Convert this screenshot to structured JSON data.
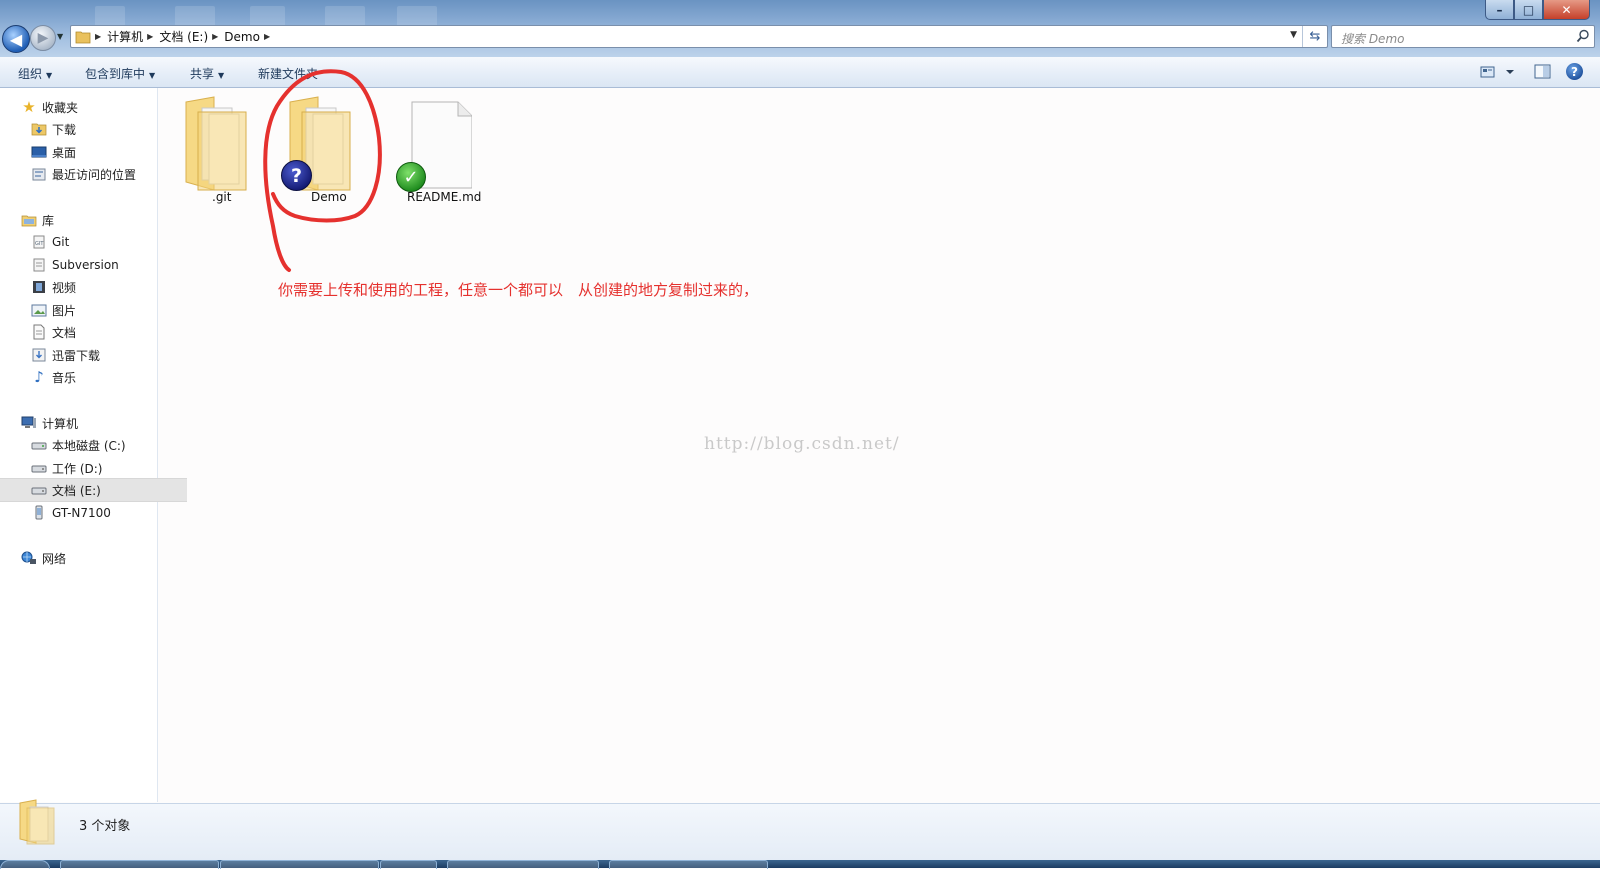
{
  "address": {
    "breadcrumbs": [
      "计算机",
      "文档 (E:)",
      "Demo"
    ]
  },
  "search": {
    "placeholder": "搜索 Demo"
  },
  "toolbar": {
    "organize": "组织",
    "include_in_library": "包含到库中",
    "share": "共享",
    "new_folder": "新建文件夹"
  },
  "window_controls": {
    "minimize": "–",
    "maximize": "□",
    "close": "✕"
  },
  "help": {
    "label": "?"
  },
  "nav": {
    "favorites": "收藏夹",
    "downloads": "下载",
    "desktop": "桌面",
    "recent": "最近访问的位置",
    "libraries": "库",
    "git": "Git",
    "subversion": "Subversion",
    "videos": "视频",
    "pictures": "图片",
    "documents": "文档",
    "thunder": "迅雷下载",
    "music": "音乐",
    "computer": "计算机",
    "drive_c": "本地磁盘 (C:)",
    "drive_d": "工作 (D:)",
    "drive_e": "文档 (E:)",
    "phone": "GT-N7100",
    "network": "网络"
  },
  "files": [
    {
      "name": ".git",
      "type": "folder",
      "overlay": "none"
    },
    {
      "name": "Demo",
      "type": "folder",
      "overlay": "question-icon"
    },
    {
      "name": "README.md",
      "type": "file",
      "overlay": "checkmark-icon"
    }
  ],
  "annotation": "你需要上传和使用的工程，任意一个都可以　从创建的地方复制过来的，",
  "watermark": "http://blog.csdn.net/",
  "details": {
    "count": "3 个对象"
  },
  "colors": {
    "annotation": "#e5312e",
    "folder": "#f3d27a",
    "selection": "#e4e4e4",
    "titlebar": "#86a9d2"
  }
}
